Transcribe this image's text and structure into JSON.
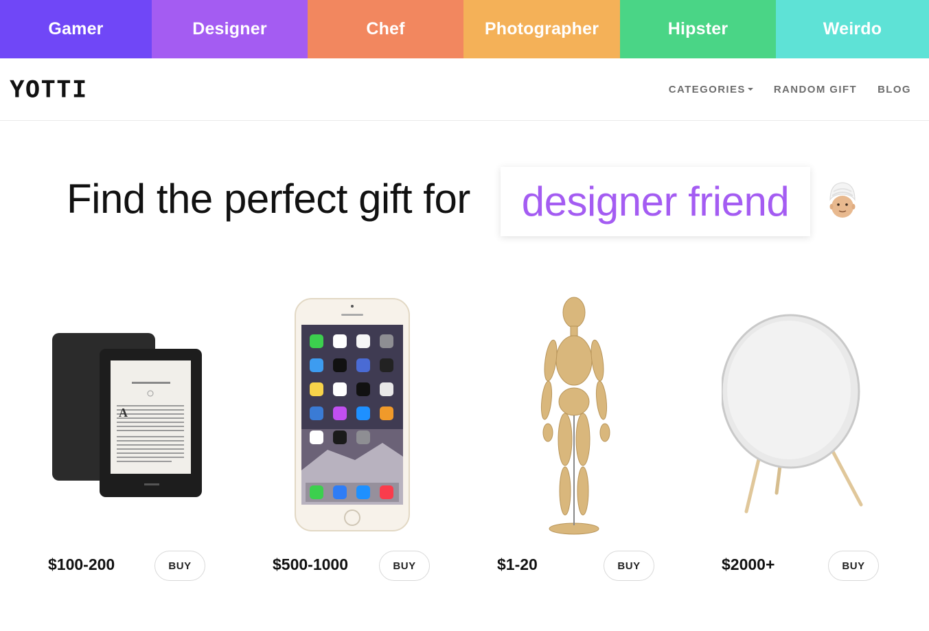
{
  "categories": [
    {
      "label": "Gamer",
      "color": "#7047f7"
    },
    {
      "label": "Designer",
      "color": "#a45cf2"
    },
    {
      "label": "Chef",
      "color": "#f2875f"
    },
    {
      "label": "Photographer",
      "color": "#f4b158"
    },
    {
      "label": "Hipster",
      "color": "#4ad586"
    },
    {
      "label": "Weirdo",
      "color": "#5ee2d6"
    }
  ],
  "header": {
    "logo": "YOTTI",
    "nav": {
      "categories": "CATEGORIES",
      "random_gift": "RANDOM GIFT",
      "blog": "BLOG"
    }
  },
  "hero": {
    "prefix": "Find the perfect gift for",
    "recipient": "designer friend",
    "accent_color": "#a45cf2",
    "emoji_icon": "person-with-turban-icon"
  },
  "products": [
    {
      "price": "$100-200",
      "buy_label": "BUY",
      "image_icon": "ereader-icon"
    },
    {
      "price": "$500-1000",
      "buy_label": "BUY",
      "image_icon": "smartphone-icon"
    },
    {
      "price": "$1-20",
      "buy_label": "BUY",
      "image_icon": "wooden-mannequin-icon"
    },
    {
      "price": "$2000+",
      "buy_label": "BUY",
      "image_icon": "speaker-icon"
    }
  ]
}
